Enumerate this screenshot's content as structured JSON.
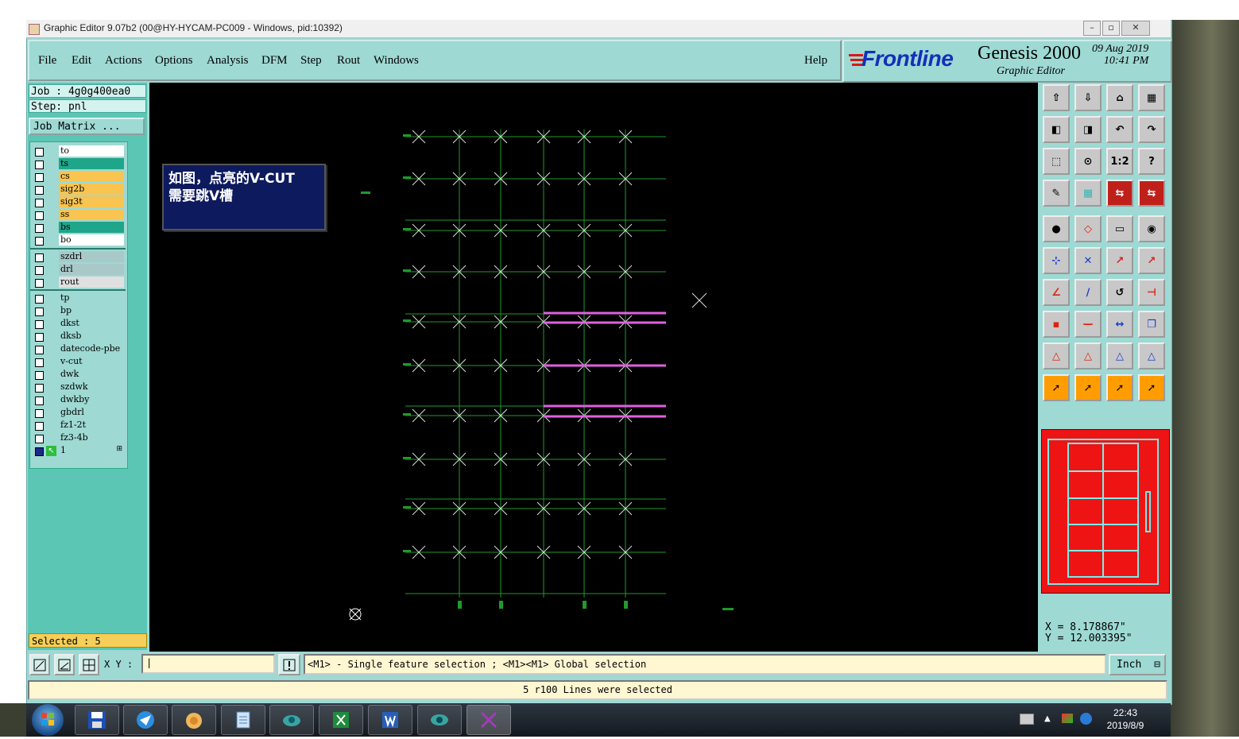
{
  "window": {
    "title": "Graphic Editor 9.07b2 (00@HY-HYCAM-PC009 - Windows, pid:10392)"
  },
  "menu": {
    "items": [
      "File",
      "Edit",
      "Actions",
      "Options",
      "Analysis",
      "DFM",
      "Step",
      "Rout",
      "Windows"
    ],
    "help": "Help"
  },
  "brand": {
    "logo": "Frontline",
    "product": "Genesis 2000",
    "subtitle": "Graphic Editor",
    "date": "09 Aug 2019",
    "time": "10:41 PM"
  },
  "job": {
    "job_label": "Job : 4g0g400ea0",
    "step_label": "Step: pnl",
    "matrix_button": "Job Matrix ..."
  },
  "layers": {
    "group1": [
      {
        "name": "to",
        "color": "#ffffff"
      },
      {
        "name": "ts",
        "color": "#1fa58a"
      },
      {
        "name": "cs",
        "color": "#f9c44f"
      },
      {
        "name": "sig2b",
        "color": "#f9c44f"
      },
      {
        "name": "sig3t",
        "color": "#f9c44f"
      },
      {
        "name": "ss",
        "color": "#f9c44f"
      },
      {
        "name": "bs",
        "color": "#1fa58a"
      },
      {
        "name": "bo",
        "color": "#ffffff"
      }
    ],
    "group2": [
      {
        "name": "szdrl",
        "color": "#a9c9c9"
      },
      {
        "name": "drl",
        "color": "#a9c9c9"
      },
      {
        "name": "rout",
        "color": "#e0e0e0"
      }
    ],
    "group3": [
      {
        "name": "tp",
        "color": "#9ed9d3"
      },
      {
        "name": "bp",
        "color": "#9ed9d3"
      },
      {
        "name": "dkst",
        "color": "#9ed9d3"
      },
      {
        "name": "dksb",
        "color": "#9ed9d3"
      },
      {
        "name": "datecode-pbe",
        "color": "#9ed9d3"
      },
      {
        "name": "v-cut",
        "color": "#9ed9d3"
      },
      {
        "name": "dwk",
        "color": "#9ed9d3"
      },
      {
        "name": "szdwk",
        "color": "#9ed9d3"
      },
      {
        "name": "dwkby",
        "color": "#9ed9d3"
      },
      {
        "name": "gbdrl",
        "color": "#9ed9d3"
      },
      {
        "name": "fz1-2t",
        "color": "#9ed9d3"
      },
      {
        "name": "fz3-4b",
        "color": "#9ed9d3"
      },
      {
        "name": "1",
        "color": "#9ed9d3"
      }
    ]
  },
  "selected": "Selected : 5",
  "note": "如图，点亮的V-CUT\n需要跳V槽",
  "coords": {
    "x": "X = 8.178867\"",
    "y": "Y = 12.003395\""
  },
  "bottom": {
    "xy_label": "X Y :",
    "prompt": "<M1> - Single feature selection ; <M1><M1> Global selection",
    "unit": "Inch"
  },
  "status": "5 r100 Lines were selected",
  "taskbar": {
    "time": "22:43",
    "date": "2019/8/9"
  },
  "toolbar_icons": [
    "open-icon",
    "save-icon",
    "home-icon",
    "panel-icon",
    "prev-icon",
    "next-icon",
    "undo-icon",
    "redo-icon",
    "zoom-fit-icon",
    "zoom-home-icon",
    "scale-1-2-icon",
    "help-icon",
    "measure-icon",
    "grid-icon",
    "snap-icon",
    "snap-active-icon",
    "pad-icon",
    "shape-icon",
    "ruler-icon",
    "circle-icon",
    "node-icon",
    "cross-icon",
    "connect-icon",
    "link-icon",
    "line-icon",
    "draw-icon",
    "arc-icon",
    "text-icon",
    "pad-add-icon",
    "line-add-icon",
    "dimension-icon",
    "contour-icon",
    "triangle-icon",
    "triangle-a-icon",
    "triangle-b-icon",
    "triangle-c-icon",
    "select-icon",
    "select-box-icon",
    "select-poly-icon",
    "select-route-icon"
  ],
  "colors": {
    "panel": "#9ed9d3",
    "canvas": "#000000",
    "grid": "#1f9a2a",
    "vcut": "#e060e0",
    "minimap": "#ee1414",
    "accent": "#ff9d00"
  }
}
